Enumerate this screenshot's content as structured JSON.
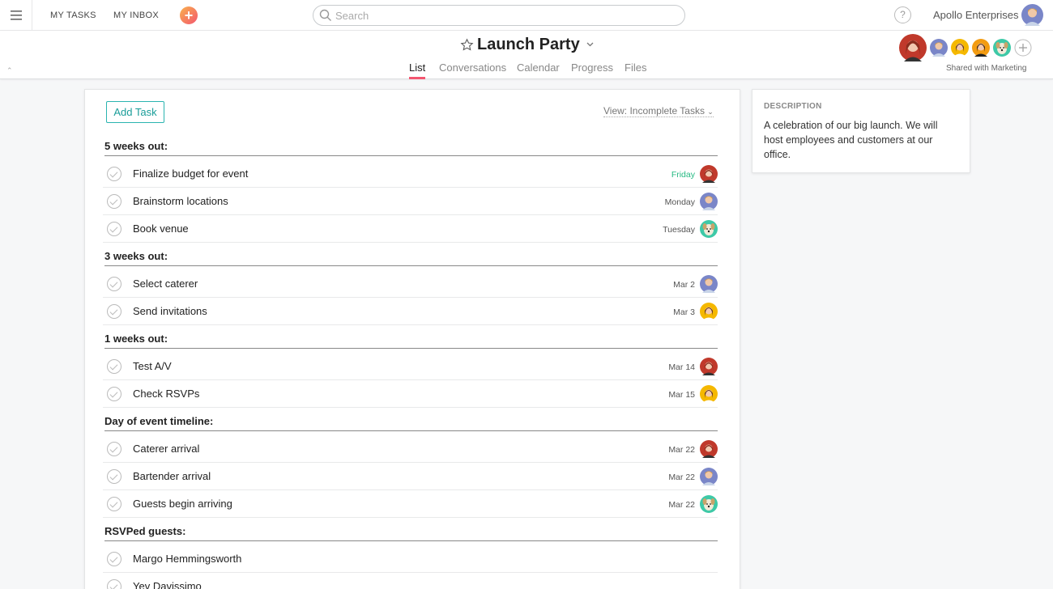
{
  "topbar": {
    "my_tasks": "MY TASKS",
    "my_inbox": "MY INBOX",
    "search_placeholder": "Search",
    "help": "?",
    "organization": "Apollo Enterprises"
  },
  "project": {
    "title": "Launch Party",
    "tabs": [
      "List",
      "Conversations",
      "Calendar",
      "Progress",
      "Files"
    ],
    "active_tab": "List",
    "shared_with": "Shared with Marketing"
  },
  "list": {
    "add_task": "Add Task",
    "view": "View: Incomplete Tasks",
    "sections": [
      {
        "title": "5 weeks out:",
        "tasks": [
          {
            "name": "Finalize budget for event",
            "due": "Friday",
            "due_soon": true,
            "assignee": "red-hair-avatar"
          },
          {
            "name": "Brainstorm locations",
            "due": "Monday",
            "due_soon": false,
            "assignee": "man-avatar"
          },
          {
            "name": "Book venue",
            "due": "Tuesday",
            "due_soon": false,
            "assignee": "dog-avatar"
          }
        ]
      },
      {
        "title": "3 weeks out:",
        "tasks": [
          {
            "name": "Select caterer",
            "due": "Mar 2",
            "due_soon": false,
            "assignee": "man-avatar"
          },
          {
            "name": "Send invitations",
            "due": "Mar 3",
            "due_soon": false,
            "assignee": "yellow-avatar"
          }
        ]
      },
      {
        "title": "1 weeks out:",
        "tasks": [
          {
            "name": "Test A/V",
            "due": "Mar 14",
            "due_soon": false,
            "assignee": "red-hair-avatar"
          },
          {
            "name": "Check RSVPs",
            "due": "Mar 15",
            "due_soon": false,
            "assignee": "yellow-avatar"
          }
        ]
      },
      {
        "title": "Day of event timeline:",
        "tasks": [
          {
            "name": "Caterer arrival",
            "due": "Mar 22",
            "due_soon": false,
            "assignee": "red-hair-avatar"
          },
          {
            "name": "Bartender arrival",
            "due": "Mar 22",
            "due_soon": false,
            "assignee": "man-avatar"
          },
          {
            "name": "Guests begin arriving",
            "due": "Mar 22",
            "due_soon": false,
            "assignee": "dog-avatar"
          }
        ]
      },
      {
        "title": "RSVPed guests:",
        "tasks": [
          {
            "name": "Margo Hemmingsworth",
            "due": "",
            "due_soon": false,
            "assignee": ""
          },
          {
            "name": "Yev Davissimo",
            "due": "",
            "due_soon": false,
            "assignee": ""
          }
        ]
      }
    ]
  },
  "description": {
    "label": "DESCRIPTION",
    "text": "A celebration of our big launch. We will host employees and customers at our office."
  },
  "colors": {
    "accent": "#f3566f",
    "add_task_border": "#2bb4b0",
    "due_soon": "#25b982"
  }
}
